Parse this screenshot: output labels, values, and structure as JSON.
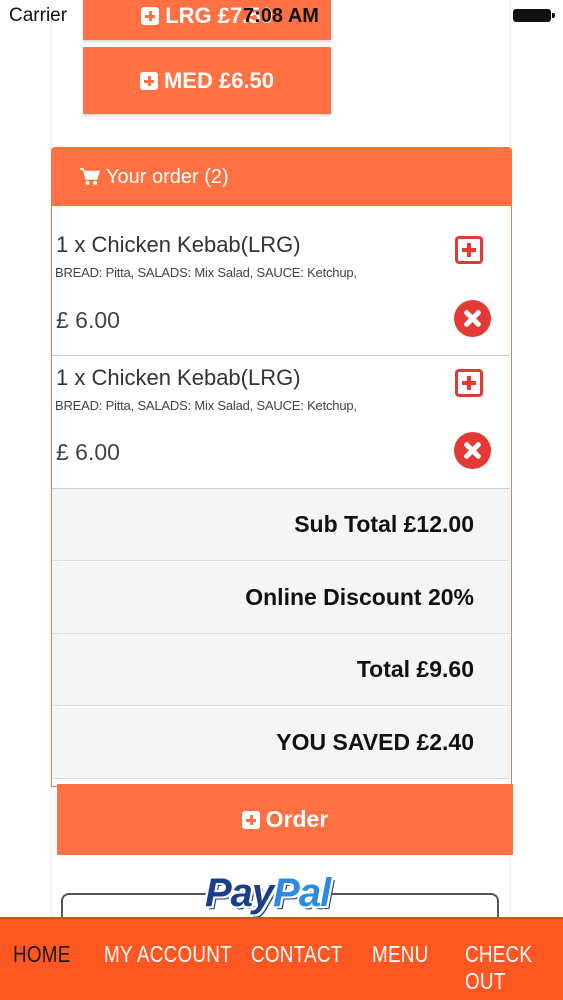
{
  "status_bar": {
    "carrier": "Carrier",
    "time": "7:08 AM"
  },
  "size_buttons": [
    {
      "label": "LRG £7.50"
    },
    {
      "label": "MED £6.50"
    }
  ],
  "order": {
    "header": "Your order (2)",
    "items": [
      {
        "title": "1 x Chicken Kebab(LRG)",
        "description": "BREAD: Pitta, SALADS: Mix Salad, SAUCE: Ketchup,",
        "price": "£ 6.00"
      },
      {
        "title": "1 x Chicken Kebab(LRG)",
        "description": "BREAD: Pitta, SALADS: Mix Salad, SAUCE: Ketchup,",
        "price": "£ 6.00"
      }
    ],
    "summary": {
      "subtotal": "Sub Total £12.00",
      "discount": "Online Discount 20%",
      "total": "Total £9.60",
      "saved": "YOU SAVED £2.40"
    },
    "order_button": "Order"
  },
  "paypal": {
    "logo_pay": "Pay",
    "logo_pal": "Pal"
  },
  "bottom_nav": {
    "items": [
      {
        "label": "HOME",
        "active": true
      },
      {
        "label": "MY ACCOUNT"
      },
      {
        "label": "CONTACT"
      },
      {
        "label": "MENU"
      },
      {
        "label": "CHECK OUT"
      }
    ]
  },
  "colors": {
    "accent": "#ff7043",
    "nav": "#ff5722",
    "danger": "#e53935"
  }
}
